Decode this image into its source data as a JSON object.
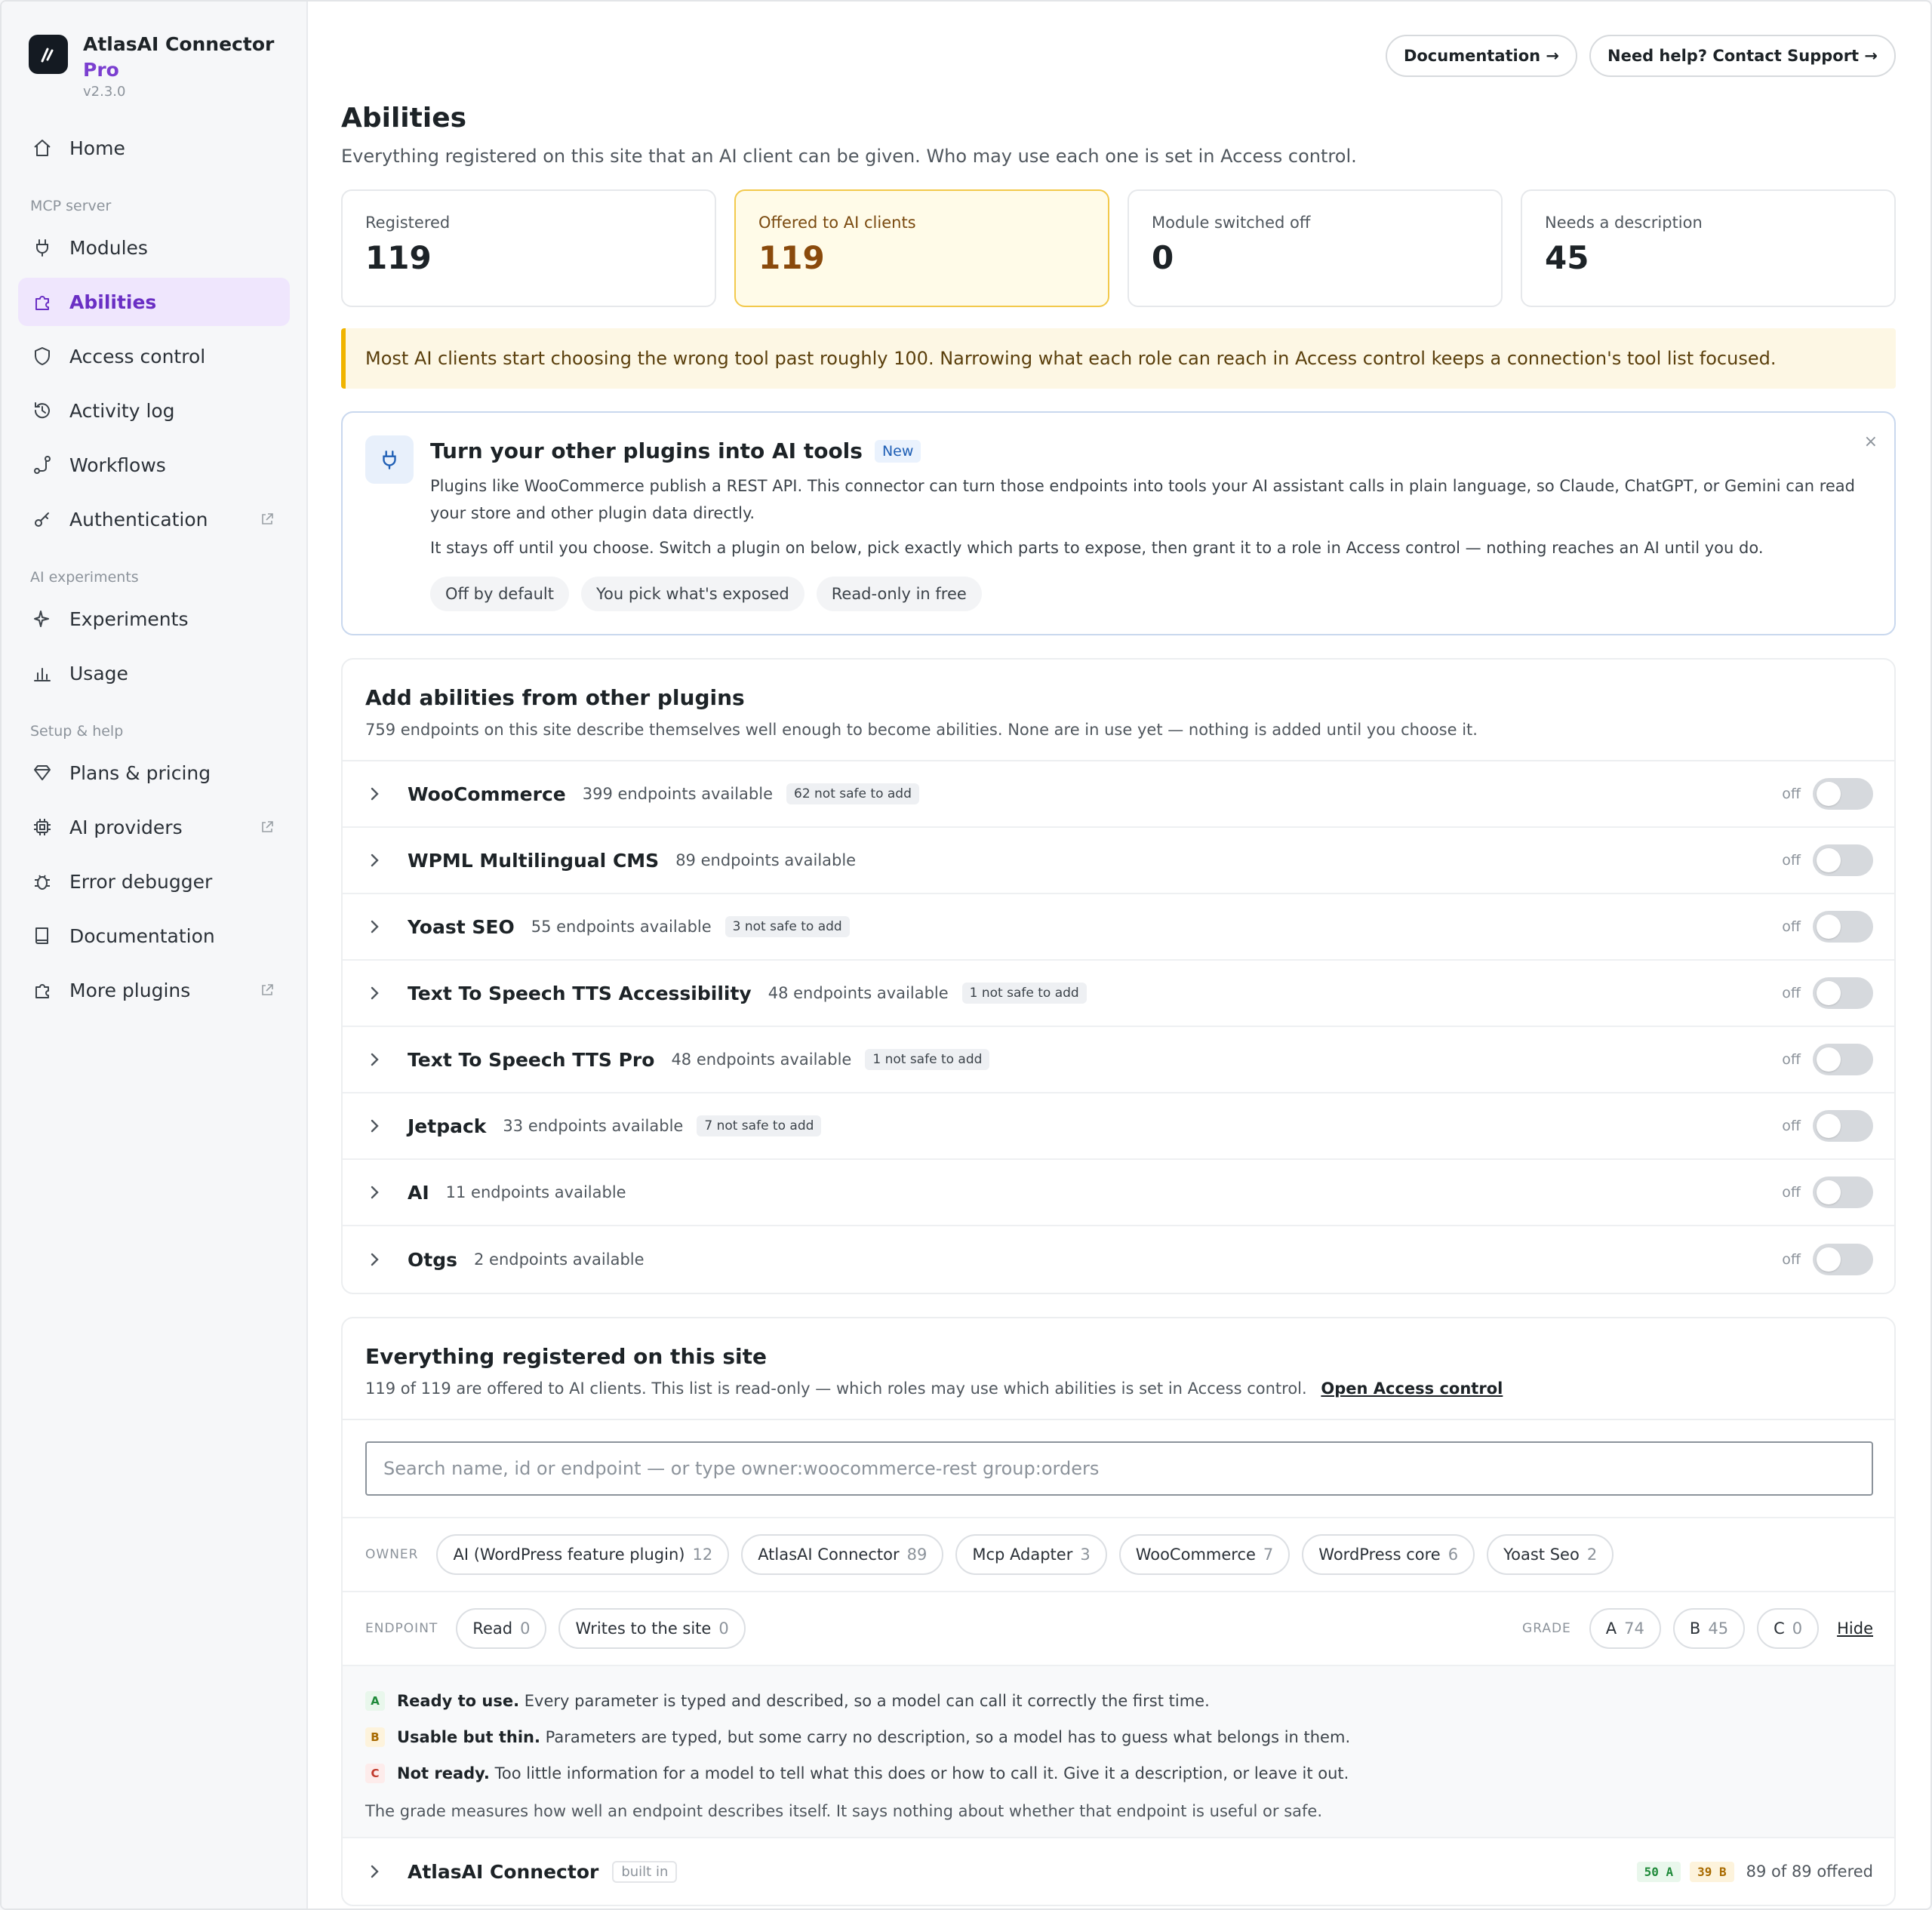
{
  "brand": {
    "name": "AtlasAI Connector",
    "tier": "Pro",
    "version": "v2.3.0"
  },
  "sidebar": {
    "home": "Home",
    "group_mcp": "MCP server",
    "modules": "Modules",
    "abilities": "Abilities",
    "access_control": "Access control",
    "activity_log": "Activity log",
    "workflows": "Workflows",
    "authentication": "Authentication",
    "group_ai": "AI experiments",
    "experiments": "Experiments",
    "usage": "Usage",
    "group_setup": "Setup & help",
    "plans": "Plans & pricing",
    "ai_providers": "AI providers",
    "error_debugger": "Error debugger",
    "documentation": "Documentation",
    "more_plugins": "More plugins"
  },
  "header": {
    "docs_btn": "Documentation →",
    "support_btn": "Need help? Contact Support →",
    "title": "Abilities",
    "subtitle": "Everything registered on this site that an AI client can be given. Who may use each one is set in Access control."
  },
  "stats": {
    "registered_label": "Registered",
    "registered_value": "119",
    "offered_label": "Offered to AI clients",
    "offered_value": "119",
    "switched_off_label": "Module switched off",
    "switched_off_value": "0",
    "needs_desc_label": "Needs a description",
    "needs_desc_value": "45"
  },
  "warning": "Most AI clients start choosing the wrong tool past roughly 100. Narrowing what each role can reach in Access control keeps a connection's tool list focused.",
  "promo": {
    "title": "Turn your other plugins into AI tools",
    "badge": "New",
    "p1": "Plugins like WooCommerce publish a REST API. This connector can turn those endpoints into tools your AI assistant calls in plain language, so Claude, ChatGPT, or Gemini can read your store and other plugin data directly.",
    "p2": "It stays off until you choose. Switch a plugin on below, pick exactly which parts to expose, then grant it to a role in Access control — nothing reaches an AI until you do.",
    "tag1": "Off by default",
    "tag2": "You pick what's exposed",
    "tag3": "Read-only in free",
    "close": "×"
  },
  "plugins_card": {
    "title": "Add abilities from other plugins",
    "subtitle": "759 endpoints on this site describe themselves well enough to become abilities. None are in use yet — nothing is added until you choose it.",
    "off_label": "off",
    "rows": [
      {
        "name": "WooCommerce",
        "count": "399 endpoints available",
        "warn": "62 not safe to add"
      },
      {
        "name": "WPML Multilingual CMS",
        "count": "89 endpoints available",
        "warn": ""
      },
      {
        "name": "Yoast SEO",
        "count": "55 endpoints available",
        "warn": "3 not safe to add"
      },
      {
        "name": "Text To Speech TTS Accessibility",
        "count": "48 endpoints available",
        "warn": "1 not safe to add"
      },
      {
        "name": "Text To Speech TTS Pro",
        "count": "48 endpoints available",
        "warn": "1 not safe to add"
      },
      {
        "name": "Jetpack",
        "count": "33 endpoints available",
        "warn": "7 not safe to add"
      },
      {
        "name": "AI",
        "count": "11 endpoints available",
        "warn": ""
      },
      {
        "name": "Otgs",
        "count": "2 endpoints available",
        "warn": ""
      }
    ]
  },
  "registry": {
    "title": "Everything registered on this site",
    "subtitle": "119 of 119 are offered to AI clients. This list is read-only — which roles may use which abilities is set in Access control.",
    "open_link": "Open Access control",
    "search_placeholder": "Search name, id or endpoint — or type owner:woocommerce-rest group:orders",
    "owner_label": "OWNER",
    "owners": [
      {
        "name": "AI (WordPress feature plugin)",
        "n": "12"
      },
      {
        "name": "AtlasAI Connector",
        "n": "89"
      },
      {
        "name": "Mcp Adapter",
        "n": "3"
      },
      {
        "name": "WooCommerce",
        "n": "7"
      },
      {
        "name": "WordPress core",
        "n": "6"
      },
      {
        "name": "Yoast Seo",
        "n": "2"
      }
    ],
    "endpoint_label": "ENDPOINT",
    "endpoint_read": "Read",
    "endpoint_read_n": "0",
    "endpoint_write": "Writes to the site",
    "endpoint_write_n": "0",
    "grade_label": "GRADE",
    "grade_a": "A",
    "grade_a_n": "74",
    "grade_b": "B",
    "grade_b_n": "45",
    "grade_c": "C",
    "grade_c_n": "0",
    "hide": "Hide",
    "legend": {
      "a_letter": "A",
      "a_bold": "Ready to use.",
      "a_text": "Every parameter is typed and described, so a model can call it correctly the first time.",
      "b_letter": "B",
      "b_bold": "Usable but thin.",
      "b_text": "Parameters are typed, but some carry no description, so a model has to guess what belongs in them.",
      "c_letter": "C",
      "c_bold": "Not ready.",
      "c_text": "Too little information for a model to tell what this does or how to call it. Give it a description, or leave it out.",
      "note": "The grade measures how well an endpoint describes itself. It says nothing about whether that endpoint is useful or safe."
    },
    "group": {
      "name": "AtlasAI Connector",
      "tag": "built in",
      "a_badge": "50 A",
      "b_badge": "39 B",
      "offered": "89 of 89 offered"
    }
  }
}
